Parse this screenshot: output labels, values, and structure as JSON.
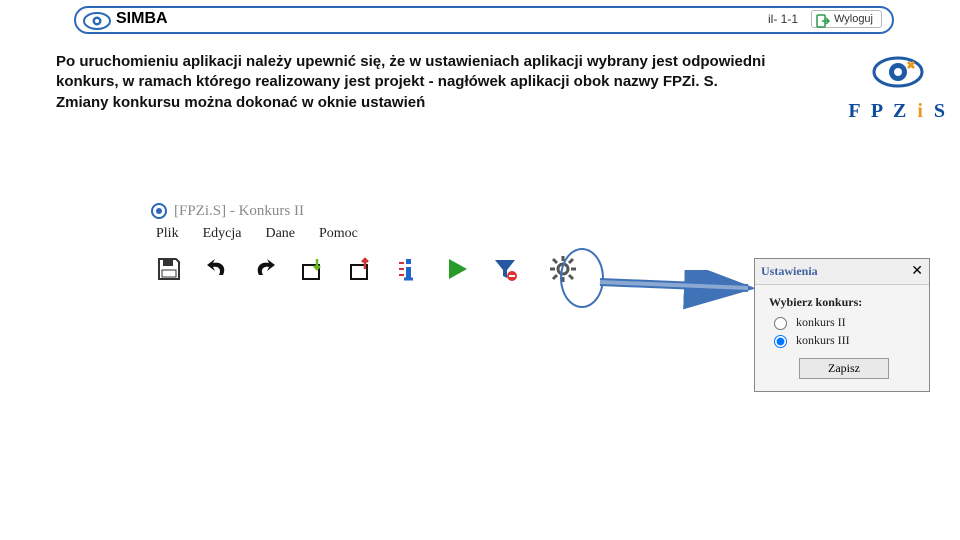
{
  "header": {
    "app_name": "SIMBA",
    "code": "il- 1-1",
    "logout_label": "Wyloguj"
  },
  "intro_text": "Po uruchomieniu aplikacji należy upewnić się, że w ustawieniach aplikacji wybrany jest odpowiedni konkurs, w ramach którego realizowany jest projekt - nagłówek aplikacji obok nazwy FPZi. S.\nZmiany konkursu można dokonać w oknie ustawień",
  "brand": {
    "left": "F P Z",
    "mid": "i",
    "right": "S"
  },
  "app_window": {
    "title": "[FPZi.S] - Konkurs II",
    "menu": [
      "Plik",
      "Edycja",
      "Dane",
      "Pomoc"
    ]
  },
  "settings_dialog": {
    "title": "Ustawienia",
    "label": "Wybierz konkurs:",
    "options": [
      {
        "label": "konkurs II",
        "checked": false
      },
      {
        "label": "konkurs III",
        "checked": true
      }
    ],
    "save": "Zapisz"
  }
}
